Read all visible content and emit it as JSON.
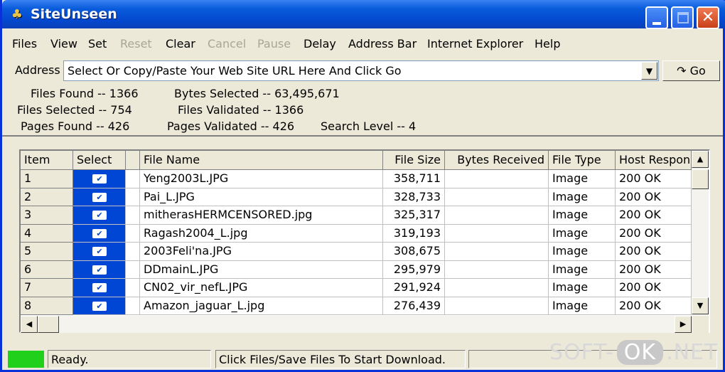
{
  "window": {
    "title": "SiteUnseen",
    "close_glyph": "✕"
  },
  "menu": [
    "Files",
    "View",
    "Set",
    "Reset",
    "Clear",
    "Cancel",
    "Pause",
    "Delay",
    "Address Bar",
    "Internet Explorer",
    "Help"
  ],
  "menu_disabled": [
    "Reset",
    "Cancel",
    "Pause"
  ],
  "address": {
    "label": "Address",
    "value": "Select Or Copy/Paste Your Web Site URL Here And Click Go",
    "go_label": "Go",
    "go_glyph": "↷",
    "dropdown_glyph": "▼"
  },
  "stats": {
    "files_found": "Files Found -- 1366",
    "files_selected": "Files Selected -- 754",
    "pages_found": "Pages Found -- 426",
    "bytes_selected": "Bytes Selected -- 63,495,671",
    "files_validated": "Files Validated -- 1366",
    "pages_validated": "Pages Validated -- 426",
    "search_level": "Search Level --  4"
  },
  "grid": {
    "headers": {
      "item": "Item",
      "select": "Select",
      "file_name": "File Name",
      "file_size": "File Size",
      "bytes_received": "Bytes Received",
      "file_type": "File Type",
      "host_response": "Host Respon"
    },
    "checkbox_glyph": "✔",
    "rows": [
      {
        "item": "1",
        "file_name": "Yeng2003L.JPG",
        "file_size": "358,711",
        "bytes_received": "",
        "file_type": "Image",
        "host_response": "200 OK"
      },
      {
        "item": "2",
        "file_name": "Pai_L.JPG",
        "file_size": "328,733",
        "bytes_received": "",
        "file_type": "Image",
        "host_response": "200 OK"
      },
      {
        "item": "3",
        "file_name": "mitherasHERMCENSORED.jpg",
        "file_size": "325,317",
        "bytes_received": "",
        "file_type": "Image",
        "host_response": "200 OK"
      },
      {
        "item": "4",
        "file_name": "Ragash2004_L.jpg",
        "file_size": "319,193",
        "bytes_received": "",
        "file_type": "Image",
        "host_response": "200 OK"
      },
      {
        "item": "5",
        "file_name": "2003Feli'na.JPG",
        "file_size": "308,675",
        "bytes_received": "",
        "file_type": "Image",
        "host_response": "200 OK"
      },
      {
        "item": "6",
        "file_name": "DDmainL.JPG",
        "file_size": "295,979",
        "bytes_received": "",
        "file_type": "Image",
        "host_response": "200 OK"
      },
      {
        "item": "7",
        "file_name": "CN02_vir_nefL.JPG",
        "file_size": "291,924",
        "bytes_received": "",
        "file_type": "Image",
        "host_response": "200 OK"
      },
      {
        "item": "8",
        "file_name": "Amazon_jaguar_L.jpg",
        "file_size": "276,439",
        "bytes_received": "",
        "file_type": "Image",
        "host_response": "200 OK"
      }
    ]
  },
  "scroll": {
    "up": "▲",
    "down": "▼",
    "left": "◀",
    "right": "▶"
  },
  "status": {
    "ready": "Ready.",
    "hint": "Click Files/Save Files To Start Download.",
    "led_color": "#21d01a"
  },
  "watermark": {
    "left": "SOFT-",
    "ok": "OK",
    "right": ".NET"
  }
}
